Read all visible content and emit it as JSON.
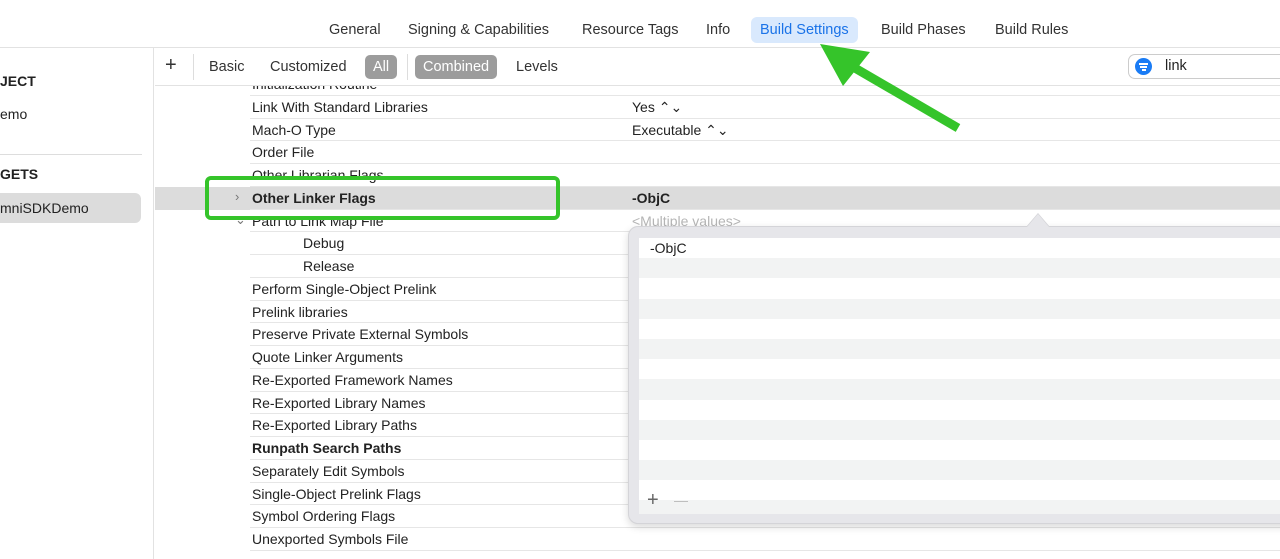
{
  "tabs": [
    {
      "label": "General"
    },
    {
      "label": "Signing & Capabilities"
    },
    {
      "label": "Resource Tags"
    },
    {
      "label": "Info"
    },
    {
      "label": "Build Settings",
      "active": true
    },
    {
      "label": "Build Phases"
    },
    {
      "label": "Build Rules"
    }
  ],
  "sidebar": {
    "project_header": "JECT",
    "project_item": "emo",
    "targets_header": "GETS",
    "target_item": "mniSDKDemo"
  },
  "toolbar": {
    "add": "+",
    "basic": "Basic",
    "customized": "Customized",
    "all": "All",
    "combined": "Combined",
    "levels": "Levels",
    "search_value": "link",
    "search_icon": "filter-icon"
  },
  "settings": [
    {
      "name": "Initialization Routine",
      "value": ""
    },
    {
      "name": "Link With Standard Libraries",
      "value": "Yes ⌃⌄"
    },
    {
      "name": "Mach-O Type",
      "value": "Executable ⌃⌄"
    },
    {
      "name": "Order File",
      "value": ""
    },
    {
      "name": "Other Librarian Flags",
      "value": ""
    },
    {
      "name": "Other Linker Flags",
      "value": "-ObjC",
      "bold": true,
      "selected": true,
      "disclosure": "›"
    },
    {
      "name": "Path to Link Map File",
      "value": "<Multiple values>",
      "placeholder": true,
      "disclosure": "⌄"
    },
    {
      "name": "Debug",
      "value": "",
      "sub": true
    },
    {
      "name": "Release",
      "value": "",
      "sub": true
    },
    {
      "name": "Perform Single-Object Prelink",
      "value": ""
    },
    {
      "name": "Prelink libraries",
      "value": ""
    },
    {
      "name": "Preserve Private External Symbols",
      "value": ""
    },
    {
      "name": "Quote Linker Arguments",
      "value": ""
    },
    {
      "name": "Re-Exported Framework Names",
      "value": ""
    },
    {
      "name": "Re-Exported Library Names",
      "value": ""
    },
    {
      "name": "Re-Exported Library Paths",
      "value": ""
    },
    {
      "name": "Runpath Search Paths",
      "value": "",
      "bold": true
    },
    {
      "name": "Separately Edit Symbols",
      "value": ""
    },
    {
      "name": "Single-Object Prelink Flags",
      "value": ""
    },
    {
      "name": "Symbol Ordering Flags",
      "value": ""
    },
    {
      "name": "Unexported Symbols File",
      "value": ""
    }
  ],
  "popover": {
    "items": [
      "-ObjC",
      "",
      "",
      "",
      "",
      "",
      "",
      "",
      "",
      "",
      "",
      "",
      "",
      ""
    ],
    "add": "+",
    "remove": "—"
  },
  "annotation": {
    "color": "#35c42a"
  }
}
